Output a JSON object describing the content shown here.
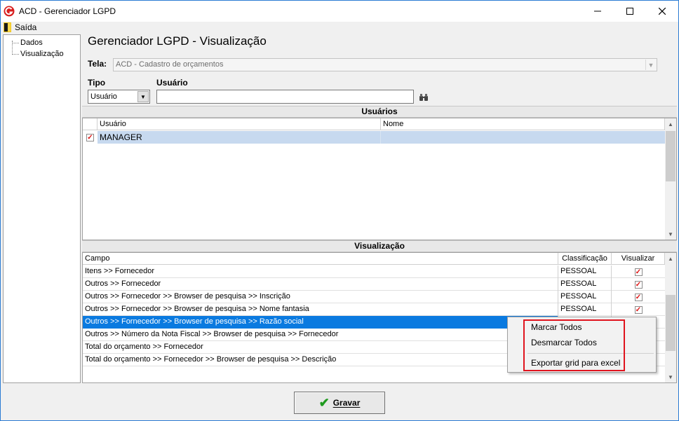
{
  "window": {
    "title": "ACD - Gerenciador LGPD"
  },
  "menu": {
    "exit_label": "Saída"
  },
  "tree": {
    "items": [
      "Dados",
      "Visualização"
    ]
  },
  "page": {
    "title": "Gerenciador LGPD - Visualização",
    "tela_label": "Tela:",
    "tela_value": "ACD - Cadastro de orçamentos",
    "tipo_label": "Tipo",
    "usuario_label": "Usuário",
    "tipo_value": "Usuário",
    "usuario_value": ""
  },
  "users_section": {
    "title": "Usuários",
    "columns": [
      "Usuário",
      "Nome"
    ],
    "rows": [
      {
        "checked": true,
        "usuario": "MANAGER",
        "nome": ""
      }
    ]
  },
  "vis_section": {
    "title": "Visualização",
    "columns": [
      "Campo",
      "Classificação",
      "Visualizar"
    ],
    "rows": [
      {
        "campo": "Itens >> Fornecedor",
        "classificacao": "PESSOAL",
        "visualizar": true
      },
      {
        "campo": "Outros >> Fornecedor",
        "classificacao": "PESSOAL",
        "visualizar": true
      },
      {
        "campo": "Outros >> Fornecedor >> Browser de pesquisa >> Inscrição",
        "classificacao": "PESSOAL",
        "visualizar": true
      },
      {
        "campo": "Outros >> Fornecedor >> Browser de pesquisa >> Nome fantasia",
        "classificacao": "PESSOAL",
        "visualizar": true
      },
      {
        "campo": "Outros >> Fornecedor >> Browser de pesquisa >> Razão social",
        "classificacao": "",
        "visualizar": false
      },
      {
        "campo": "Outros >> Número da Nota Fiscal >> Browser de pesquisa >> Fornecedor",
        "classificacao": "",
        "visualizar": false
      },
      {
        "campo": "Total do orçamento >> Fornecedor",
        "classificacao": "",
        "visualizar": false
      },
      {
        "campo": "Total do orçamento >> Fornecedor >> Browser de pesquisa >> Descrição",
        "classificacao": "",
        "visualizar": false
      }
    ]
  },
  "context_menu": {
    "items": [
      "Marcar Todos",
      "Desmarcar Todos",
      "Exportar grid para excel"
    ]
  },
  "footer": {
    "save_label": "Gravar"
  },
  "colors": {
    "selection_blue": "#0a7ae0",
    "row_highlight": "#c7d9ef",
    "callout_red": "#e0141e",
    "check_red": "#dd1111"
  }
}
